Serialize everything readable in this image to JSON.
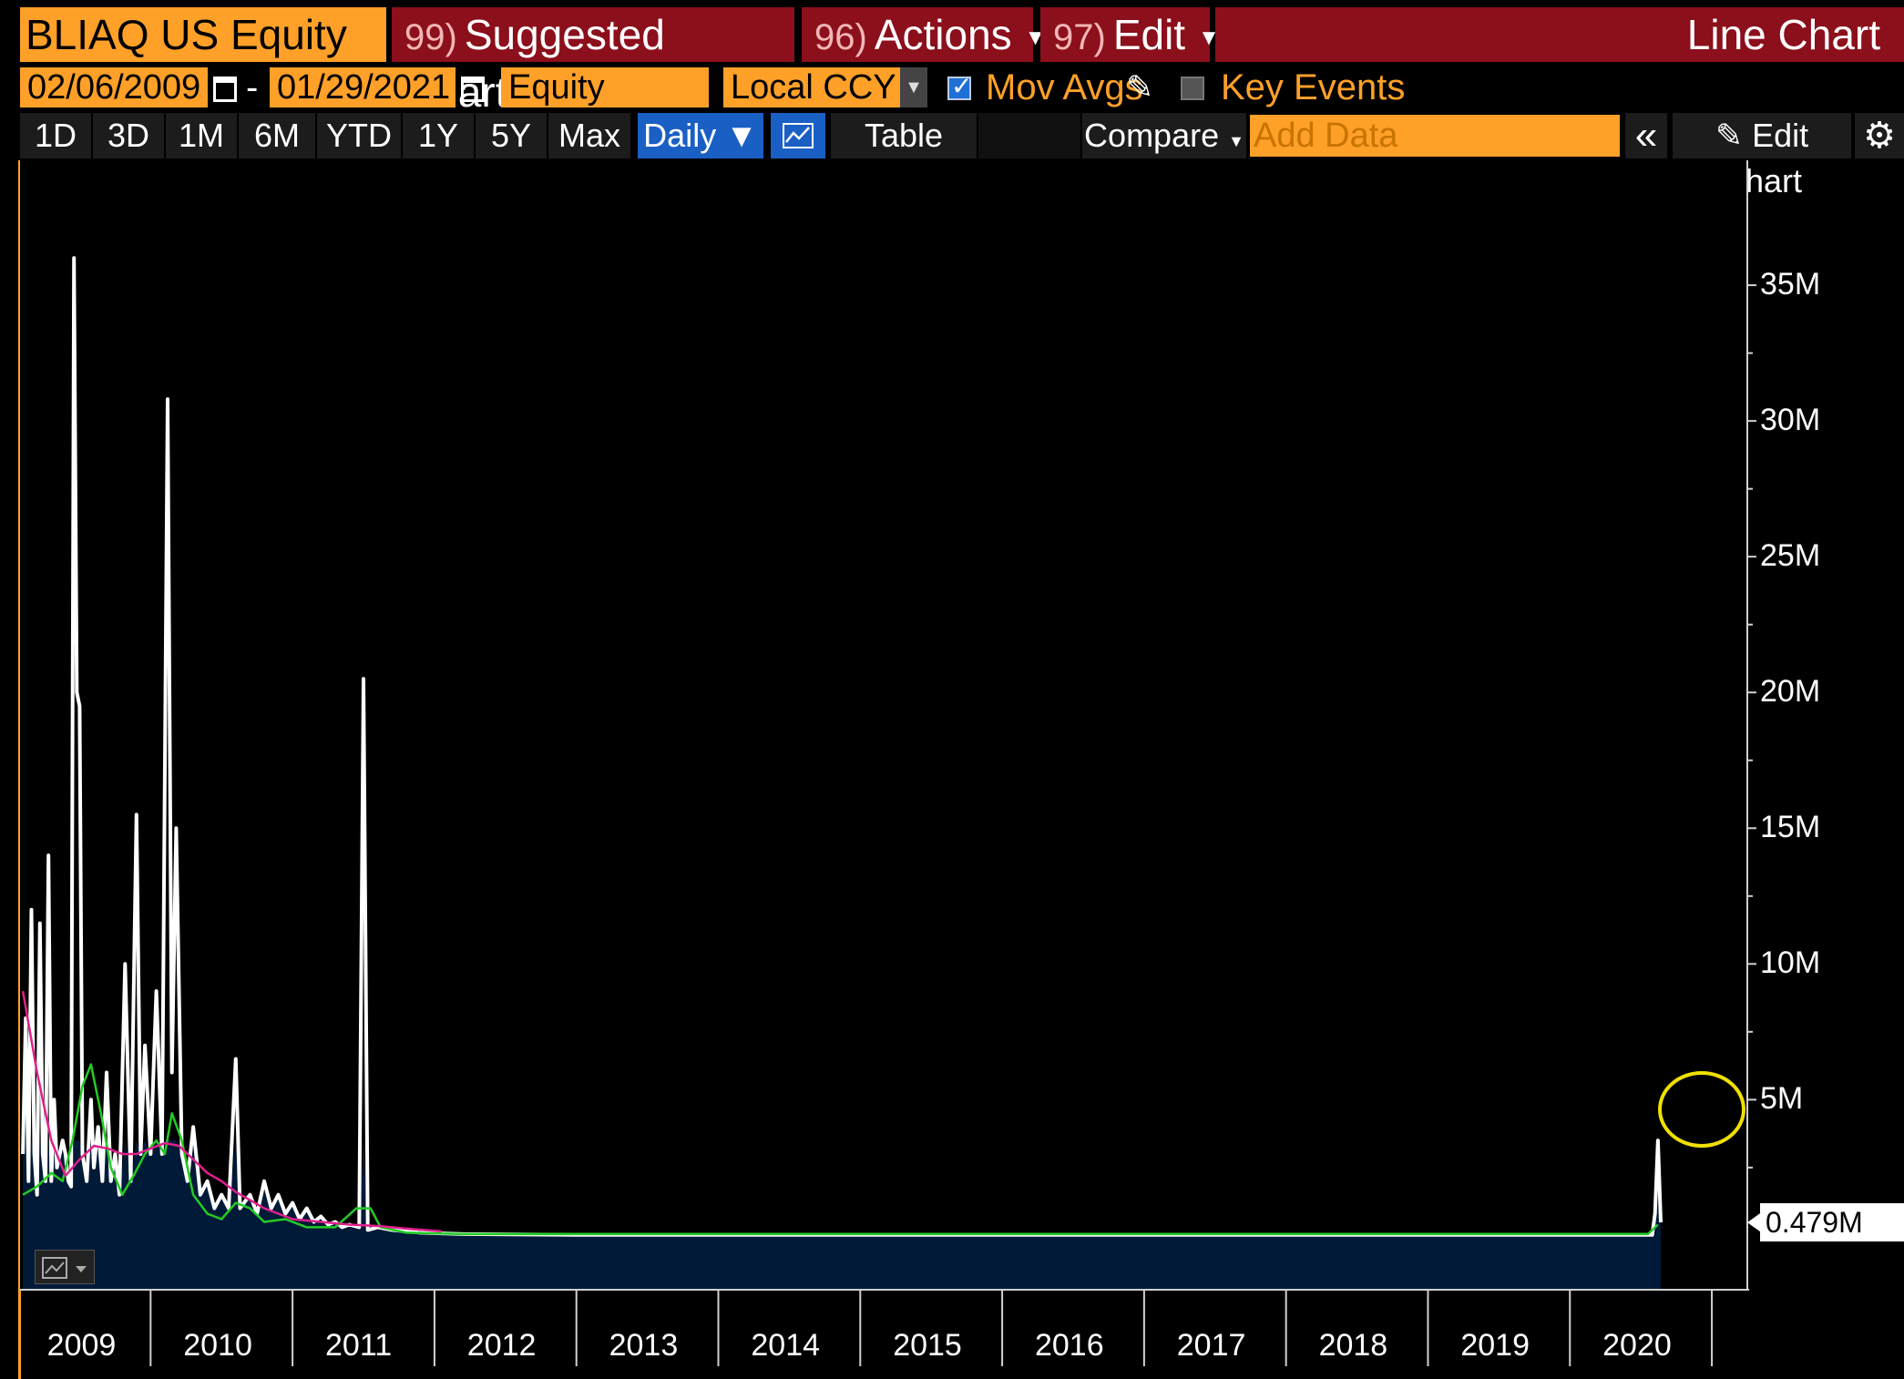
{
  "header": {
    "security": "BLIAQ US Equity",
    "menus": [
      {
        "num": "99)",
        "label": "Suggested Charts"
      },
      {
        "num": "96)",
        "label": "Actions"
      },
      {
        "num": "97)",
        "label": "Edit"
      }
    ],
    "chart_type": "Line Chart"
  },
  "controls": {
    "start_date": "02/06/2009",
    "date_separator": "-",
    "end_date": "01/29/2021",
    "market": "Equity Tradec",
    "currency": "Local CCY",
    "mov_avgs_label": "Mov Avgs",
    "mov_avgs_checked": true,
    "key_events_label": "Key Events",
    "key_events_checked": false
  },
  "toolbar": {
    "ranges": [
      "1D",
      "3D",
      "1M",
      "6M",
      "YTD",
      "1Y",
      "5Y",
      "Max"
    ],
    "frequency": "Daily ▼",
    "table_label": "Table",
    "compare_label": "Compare",
    "add_data_placeholder": "Add Data",
    "collapse_label": "«",
    "edit_chart_label": "Edit Chart"
  },
  "chart_data": {
    "type": "line",
    "y_ticks": [
      "35M",
      "30M",
      "25M",
      "20M",
      "15M",
      "10M",
      "5M"
    ],
    "y_tick_values": [
      35,
      30,
      25,
      20,
      15,
      10,
      5
    ],
    "ylim": [
      -2,
      39.6
    ],
    "x_ticks": [
      "2009",
      "2010",
      "2011",
      "2012",
      "2013",
      "2014",
      "2015",
      "2016",
      "2017",
      "2018",
      "2019",
      "2020"
    ],
    "last_value_label": "0.479M",
    "last_value": 0.479,
    "colors": {
      "volume": "#ffffff",
      "fill": "#001a38",
      "ma_fast": "#22cc22",
      "ma_slow": "#e0208c",
      "highlight": "#f0e000"
    },
    "series": [
      {
        "values": [
          [
            2009.1,
            3
          ],
          [
            2009.12,
            8
          ],
          [
            2009.14,
            2
          ],
          [
            2009.16,
            12
          ],
          [
            2009.18,
            3
          ],
          [
            2009.2,
            1.5
          ],
          [
            2009.22,
            11.5
          ],
          [
            2009.24,
            3
          ],
          [
            2009.26,
            2
          ],
          [
            2009.28,
            14
          ],
          [
            2009.3,
            2
          ],
          [
            2009.32,
            5
          ],
          [
            2009.34,
            2.5
          ],
          [
            2009.36,
            3
          ],
          [
            2009.38,
            3.5
          ],
          [
            2009.4,
            3
          ],
          [
            2009.42,
            2
          ],
          [
            2009.44,
            1.8
          ],
          [
            2009.46,
            36
          ],
          [
            2009.48,
            20
          ],
          [
            2009.5,
            19.5
          ],
          [
            2009.52,
            3
          ],
          [
            2009.55,
            2
          ],
          [
            2009.58,
            5
          ],
          [
            2009.6,
            2.5
          ],
          [
            2009.63,
            4
          ],
          [
            2009.66,
            2
          ],
          [
            2009.69,
            6
          ],
          [
            2009.72,
            2
          ],
          [
            2009.75,
            3
          ],
          [
            2009.78,
            1.5
          ],
          [
            2009.82,
            10
          ],
          [
            2009.86,
            2
          ],
          [
            2009.9,
            15.5
          ],
          [
            2009.93,
            3
          ],
          [
            2009.96,
            7
          ],
          [
            2010.0,
            3
          ],
          [
            2010.04,
            9
          ],
          [
            2010.08,
            3
          ],
          [
            2010.12,
            30.8
          ],
          [
            2010.15,
            6
          ],
          [
            2010.18,
            15
          ],
          [
            2010.22,
            3
          ],
          [
            2010.26,
            2
          ],
          [
            2010.3,
            4
          ],
          [
            2010.35,
            1.5
          ],
          [
            2010.4,
            2
          ],
          [
            2010.45,
            1
          ],
          [
            2010.5,
            1.5
          ],
          [
            2010.55,
            1
          ],
          [
            2010.6,
            6.5
          ],
          [
            2010.63,
            1
          ],
          [
            2010.7,
            1.5
          ],
          [
            2010.75,
            0.8
          ],
          [
            2010.8,
            2
          ],
          [
            2010.85,
            1
          ],
          [
            2010.9,
            1.5
          ],
          [
            2010.95,
            0.8
          ],
          [
            2011.0,
            1.2
          ],
          [
            2011.05,
            0.6
          ],
          [
            2011.1,
            1
          ],
          [
            2011.15,
            0.5
          ],
          [
            2011.2,
            0.7
          ],
          [
            2011.25,
            0.4
          ],
          [
            2011.3,
            0.5
          ],
          [
            2011.35,
            0.3
          ],
          [
            2011.4,
            0.4
          ],
          [
            2011.47,
            0.3
          ],
          [
            2011.5,
            20.5
          ],
          [
            2011.53,
            0.2
          ],
          [
            2011.6,
            0.3
          ],
          [
            2011.7,
            0.2
          ],
          [
            2011.9,
            0.1
          ],
          [
            2012.2,
            0.05
          ],
          [
            2013.0,
            0.02
          ],
          [
            2015.0,
            0.02
          ],
          [
            2017.0,
            0.02
          ],
          [
            2019.0,
            0.02
          ],
          [
            2020.58,
            0.02
          ],
          [
            2020.6,
            0.8
          ],
          [
            2020.62,
            3.5
          ],
          [
            2020.64,
            0.479
          ]
        ]
      },
      {
        "values": [
          [
            2009.1,
            1.5
          ],
          [
            2009.2,
            1.8
          ],
          [
            2009.3,
            2.3
          ],
          [
            2009.38,
            2.0
          ],
          [
            2009.45,
            3.5
          ],
          [
            2009.52,
            5.5
          ],
          [
            2009.58,
            6.3
          ],
          [
            2009.65,
            4.5
          ],
          [
            2009.72,
            2.5
          ],
          [
            2009.8,
            1.5
          ],
          [
            2009.88,
            2.2
          ],
          [
            2009.96,
            3.0
          ],
          [
            2010.04,
            3.5
          ],
          [
            2010.1,
            3.0
          ],
          [
            2010.15,
            4.5
          ],
          [
            2010.22,
            3.5
          ],
          [
            2010.3,
            1.5
          ],
          [
            2010.4,
            0.8
          ],
          [
            2010.5,
            0.6
          ],
          [
            2010.6,
            1.2
          ],
          [
            2010.7,
            1.0
          ],
          [
            2010.8,
            0.5
          ],
          [
            2010.95,
            0.6
          ],
          [
            2011.1,
            0.3
          ],
          [
            2011.3,
            0.3
          ],
          [
            2011.45,
            1.0
          ],
          [
            2011.55,
            1.0
          ],
          [
            2011.62,
            0.3
          ],
          [
            2011.8,
            0.1
          ],
          [
            2012.2,
            0.05
          ],
          [
            2016.0,
            0.05
          ],
          [
            2020.55,
            0.05
          ],
          [
            2020.62,
            0.4
          ]
        ]
      },
      {
        "values": [
          [
            2009.1,
            9
          ],
          [
            2009.2,
            6
          ],
          [
            2009.3,
            3.5
          ],
          [
            2009.4,
            2.2
          ],
          [
            2009.5,
            2.8
          ],
          [
            2009.6,
            3.3
          ],
          [
            2009.7,
            3.2
          ],
          [
            2009.8,
            3.0
          ],
          [
            2009.9,
            3.0
          ],
          [
            2010.0,
            3.2
          ],
          [
            2010.1,
            3.4
          ],
          [
            2010.2,
            3.3
          ],
          [
            2010.3,
            2.8
          ],
          [
            2010.4,
            2.3
          ],
          [
            2010.5,
            2.0
          ],
          [
            2010.6,
            1.6
          ],
          [
            2010.7,
            1.3
          ],
          [
            2010.8,
            1.0
          ],
          [
            2010.9,
            0.8
          ],
          [
            2011.0,
            0.6
          ],
          [
            2011.2,
            0.5
          ],
          [
            2011.4,
            0.4
          ],
          [
            2011.6,
            0.35
          ],
          [
            2011.8,
            0.25
          ],
          [
            2012.05,
            0.15
          ]
        ]
      }
    ]
  }
}
